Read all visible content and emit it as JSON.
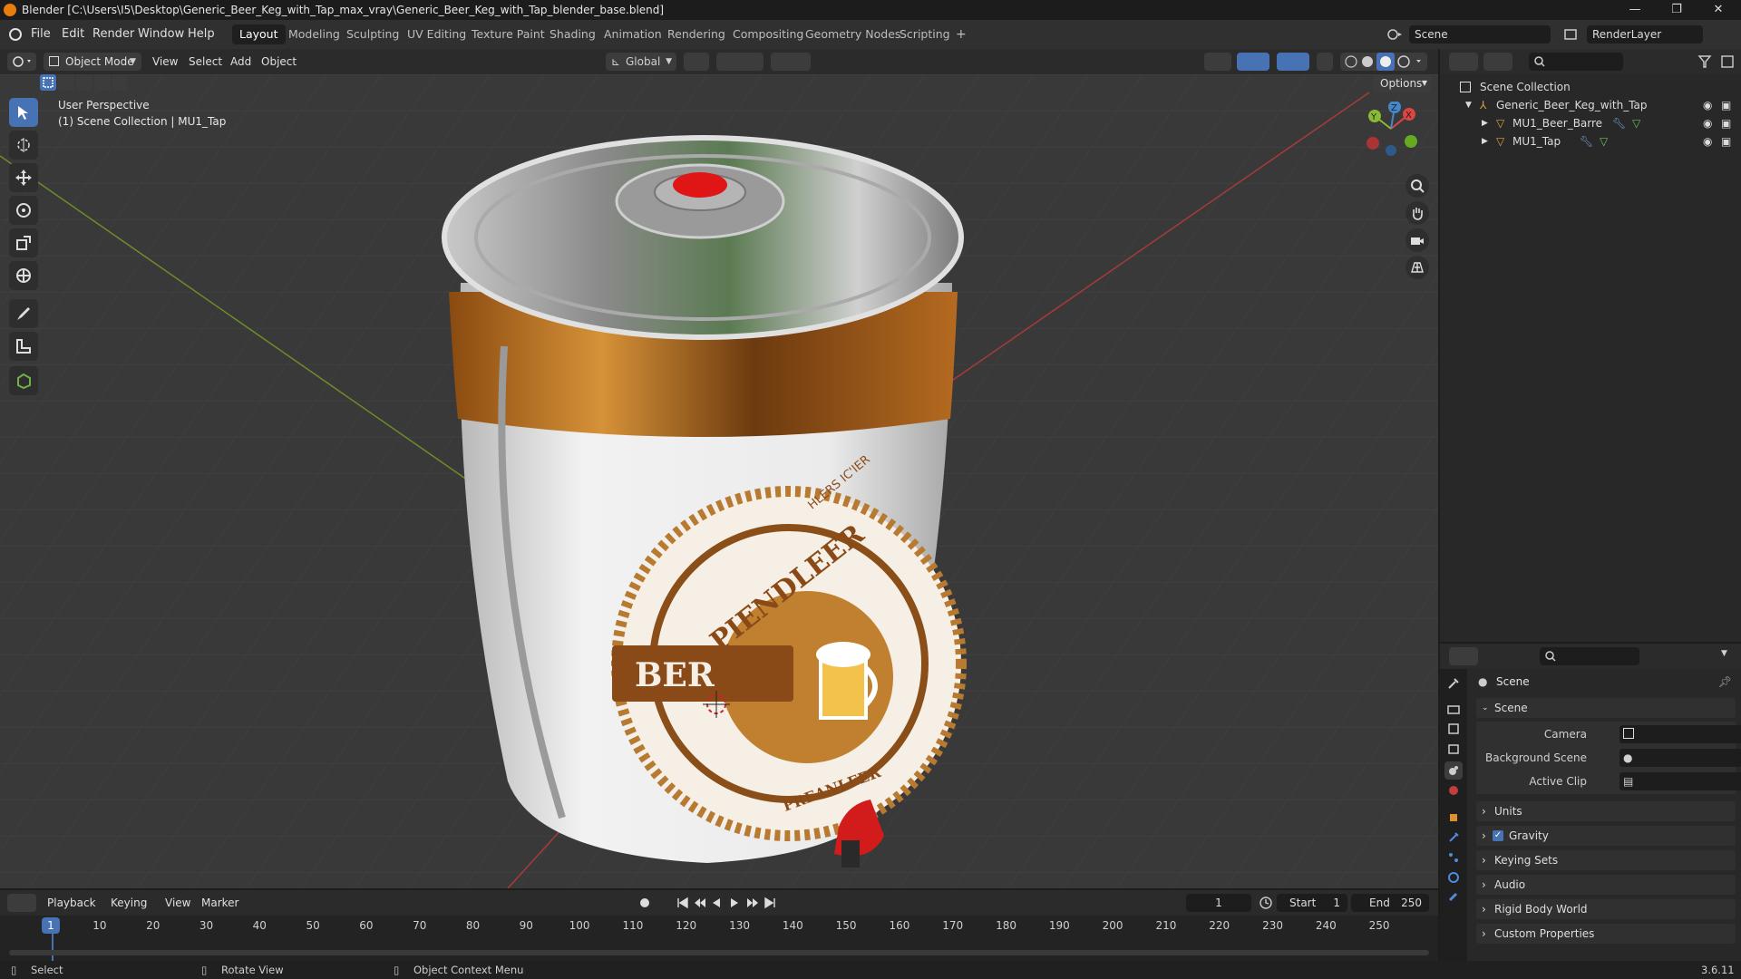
{
  "titlebar": {
    "title": "Blender [C:\\Users\\I5\\Desktop\\Generic_Beer_Keg_with_Tap_max_vray\\Generic_Beer_Keg_with_Tap_blender_base.blend]",
    "minimize": "—",
    "restore": "❐",
    "close": "✕"
  },
  "menubar": {
    "items": [
      "File",
      "Edit",
      "Render",
      "Window",
      "Help"
    ],
    "workspaces": [
      "Layout",
      "Modeling",
      "Sculpting",
      "UV Editing",
      "Texture Paint",
      "Shading",
      "Animation",
      "Rendering",
      "Compositing",
      "Geometry Nodes",
      "Scripting"
    ],
    "add_workspace": "+",
    "scene": "Scene",
    "view_layer": "RenderLayer"
  },
  "viewport_header": {
    "mode": "Object Mode",
    "menus": [
      "View",
      "Select",
      "Add",
      "Object"
    ],
    "orientation": "Global",
    "options": "Options"
  },
  "viewport": {
    "perspective": "User Perspective",
    "collection_info": "(1) Scene Collection | MU1_Tap",
    "gizmo": {
      "x": "X",
      "y": "Y",
      "z": "Z"
    },
    "keg_label": {
      "main": "BER",
      "arc_top": "PIENDLEER",
      "arc_bottom": "PREANLEER",
      "small": "HLERS IC'IER"
    }
  },
  "outliner": {
    "root": "Scene Collection",
    "collection": "Generic_Beer_Keg_with_Tap",
    "objects": [
      "MU1_Beer_Barre",
      "MU1_Tap"
    ]
  },
  "properties": {
    "context": "Scene",
    "panel_scene": "Scene",
    "fields": [
      {
        "label": "Camera",
        "value": ""
      },
      {
        "label": "Background Scene",
        "value": ""
      },
      {
        "label": "Active Clip",
        "value": ""
      }
    ],
    "collapsed_panels": [
      "Units",
      "Gravity",
      "Keying Sets",
      "Audio",
      "Rigid Body World",
      "Custom Properties"
    ],
    "gravity_checked": true
  },
  "timeline": {
    "menus": [
      "Playback",
      "Keying",
      "View",
      "Marker"
    ],
    "current_frame": "1",
    "start_label": "Start",
    "start": "1",
    "end_label": "End",
    "end": "250",
    "frame_marks": [
      "1",
      "10",
      "20",
      "30",
      "40",
      "50",
      "60",
      "70",
      "80",
      "90",
      "100",
      "110",
      "120",
      "130",
      "140",
      "150",
      "160",
      "170",
      "180",
      "190",
      "200",
      "210",
      "220",
      "230",
      "240",
      "250"
    ],
    "playhead": "1"
  },
  "statusbar": {
    "select": "Select",
    "rotate": "Rotate View",
    "context_menu": "Object Context Menu",
    "version": "3.6.11"
  }
}
